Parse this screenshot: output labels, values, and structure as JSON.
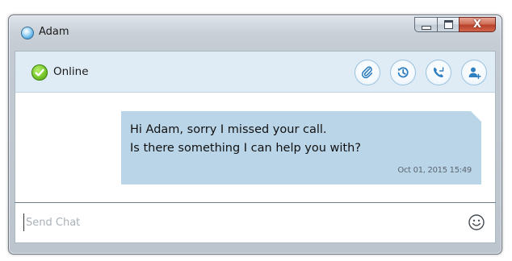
{
  "window": {
    "title": "Adam",
    "controls": {
      "minimize": "minimize-icon",
      "maximize": "maximize-icon",
      "close_glyph": "X"
    }
  },
  "status": {
    "text": "Online",
    "icon": "online-check-icon",
    "color": "#74c52a"
  },
  "actions": [
    {
      "name": "attach-file-button",
      "icon": "paperclip-icon"
    },
    {
      "name": "history-button",
      "icon": "history-icon"
    },
    {
      "name": "call-button",
      "icon": "phone-icon"
    },
    {
      "name": "add-contact-button",
      "icon": "add-user-icon"
    }
  ],
  "messages": [
    {
      "lines": [
        "Hi Adam, sorry I missed your call.",
        "Is there something I can help you with?"
      ],
      "timestamp": "Oct 01, 2015 15:49"
    }
  ],
  "input": {
    "placeholder": "Send Chat",
    "value": ""
  },
  "colors": {
    "accent": "#2f7fc1",
    "bubble": "#bad5e8",
    "status_bar": "#e0ecf5"
  }
}
